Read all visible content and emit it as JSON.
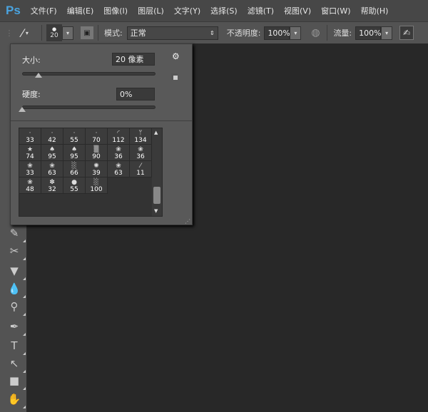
{
  "app": {
    "logo": "Ps"
  },
  "menu": [
    "文件(F)",
    "编辑(E)",
    "图像(I)",
    "图层(L)",
    "文字(Y)",
    "选择(S)",
    "滤镜(T)",
    "视图(V)",
    "窗口(W)",
    "帮助(H)"
  ],
  "options": {
    "brush_size": "20",
    "mode_label": "模式:",
    "mode_value": "正常",
    "opacity_label": "不透明度:",
    "opacity_value": "100%",
    "flow_label": "流量:",
    "flow_value": "100%"
  },
  "panel": {
    "size_label": "大小:",
    "size_value": "20 像素",
    "size_fraction": 0.04,
    "hardness_label": "硬度:",
    "hardness_value": "0%",
    "hardness_fraction": 0
  },
  "brushes": [
    {
      "size": "33",
      "icon": "·"
    },
    {
      "size": "42",
      "icon": "·"
    },
    {
      "size": "55",
      "icon": "·"
    },
    {
      "size": "70",
      "icon": "·"
    },
    {
      "size": "112",
      "icon": "◜"
    },
    {
      "size": "134",
      "icon": "ᛘ"
    },
    {
      "size": "74",
      "icon": "★"
    },
    {
      "size": "95",
      "icon": "♠"
    },
    {
      "size": "95",
      "icon": "♠"
    },
    {
      "size": "90",
      "icon": "▒"
    },
    {
      "size": "36",
      "icon": "❀"
    },
    {
      "size": "36",
      "icon": "❀"
    },
    {
      "size": "33",
      "icon": "❀"
    },
    {
      "size": "63",
      "icon": "❀"
    },
    {
      "size": "66",
      "icon": "░"
    },
    {
      "size": "39",
      "icon": "✺"
    },
    {
      "size": "63",
      "icon": "❀"
    },
    {
      "size": "11",
      "icon": "⁄"
    },
    {
      "size": "48",
      "icon": "❀"
    },
    {
      "size": "32",
      "icon": "✽"
    },
    {
      "size": "55",
      "icon": "●"
    },
    {
      "size": "100",
      "icon": "░"
    }
  ],
  "tools": [
    {
      "name": "history-brush",
      "glyph": "✎"
    },
    {
      "name": "eraser",
      "glyph": "✂"
    },
    {
      "name": "paint-bucket",
      "glyph": "▼"
    },
    {
      "name": "blur",
      "glyph": "💧"
    },
    {
      "name": "dodge",
      "glyph": "⚲"
    },
    {
      "name": "pen",
      "glyph": "✒"
    },
    {
      "name": "type",
      "glyph": "T"
    },
    {
      "name": "path-selection",
      "glyph": "↖"
    },
    {
      "name": "rectangle",
      "glyph": "■"
    },
    {
      "name": "hand",
      "glyph": "✋"
    }
  ]
}
